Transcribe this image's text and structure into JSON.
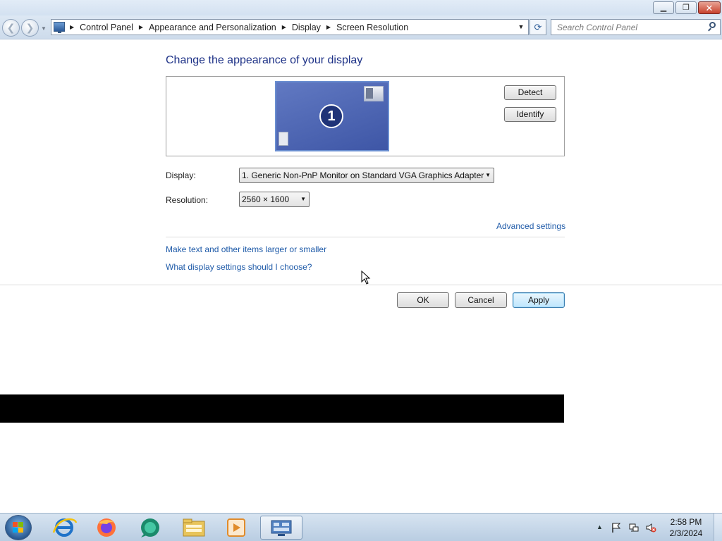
{
  "window": {
    "controls": {
      "minimize_glyph": "▁",
      "maximize_glyph": "❐",
      "close_glyph": "✕"
    }
  },
  "navigation": {
    "back_glyph": "❮",
    "forward_glyph": "❯",
    "breadcrumbs": [
      "Control Panel",
      "Appearance and Personalization",
      "Display",
      "Screen Resolution"
    ],
    "refresh_glyph": "⟳",
    "search_placeholder": "Search Control Panel"
  },
  "main": {
    "heading": "Change the appearance of your display",
    "monitor_number": "1",
    "detect_label": "Detect",
    "identify_label": "Identify",
    "display_label": "Display:",
    "display_value": "1. Generic Non-PnP Monitor on Standard VGA Graphics Adapter",
    "resolution_label": "Resolution:",
    "resolution_value": "2560 × 1600",
    "advanced_settings_link": "Advanced settings",
    "text_size_link": "Make text and other items larger or smaller",
    "help_link": "What display settings should I choose?"
  },
  "actions": {
    "ok_label": "OK",
    "cancel_label": "Cancel",
    "apply_label": "Apply"
  },
  "taskbar": {
    "pinned_icons": [
      "internet-explorer-icon",
      "firefox-icon",
      "media-app-icon",
      "file-explorer-icon",
      "media-player-icon",
      "control-panel-icon"
    ],
    "tray_icons": [
      "flag-icon",
      "network-icon",
      "volume-muted-icon"
    ],
    "time": "2:58 PM",
    "date": "2/3/2024"
  },
  "colors": {
    "heading": "#1e3287",
    "link": "#1e5aa8",
    "monitor_fill": "#4f66b3"
  }
}
